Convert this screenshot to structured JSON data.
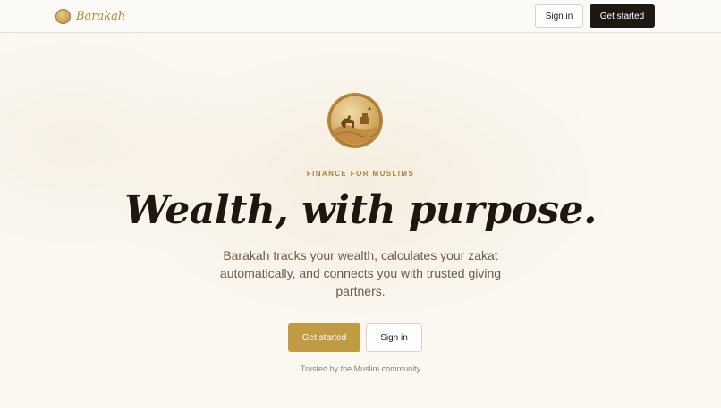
{
  "brand": {
    "name": "Barakah",
    "logo_icon": "coin-logo-icon"
  },
  "nav": {
    "sign_in_label": "Sign in",
    "get_started_label": "Get started"
  },
  "hero": {
    "illustration": "coin-camel-desert-icon",
    "eyebrow": "FINANCE FOR MUSLIMS",
    "headline": "Wealth, with purpose.",
    "subtitle": "Barakah tracks your wealth, calculates your zakat automatically, and connects you with trusted giving partners.",
    "primary_cta": "Get started",
    "secondary_cta": "Sign in",
    "trust_note": "Trusted by the Muslim community"
  },
  "colors": {
    "accent": "#c19a44",
    "background": "#fbf8f2",
    "dark": "#1e1812",
    "headline": "#1d1710"
  }
}
